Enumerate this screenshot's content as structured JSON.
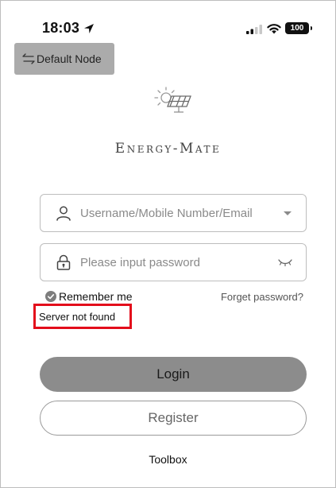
{
  "status_bar": {
    "time": "18:03",
    "battery": "100"
  },
  "node_button": {
    "label": "Default Node"
  },
  "brand": {
    "name": "Energy-Mate"
  },
  "login_form": {
    "username_placeholder": "Username/Mobile Number/Email",
    "password_placeholder": "Please input password",
    "remember_label": "Remember me",
    "forgot_label": "Forget password?",
    "error_message": "Server not found",
    "login_label": "Login",
    "register_label": "Register",
    "toolbox_label": "Toolbox"
  },
  "colors": {
    "error_border": "#e30d1b",
    "login_button": "#8c8c8c",
    "node_button": "#ababab"
  }
}
